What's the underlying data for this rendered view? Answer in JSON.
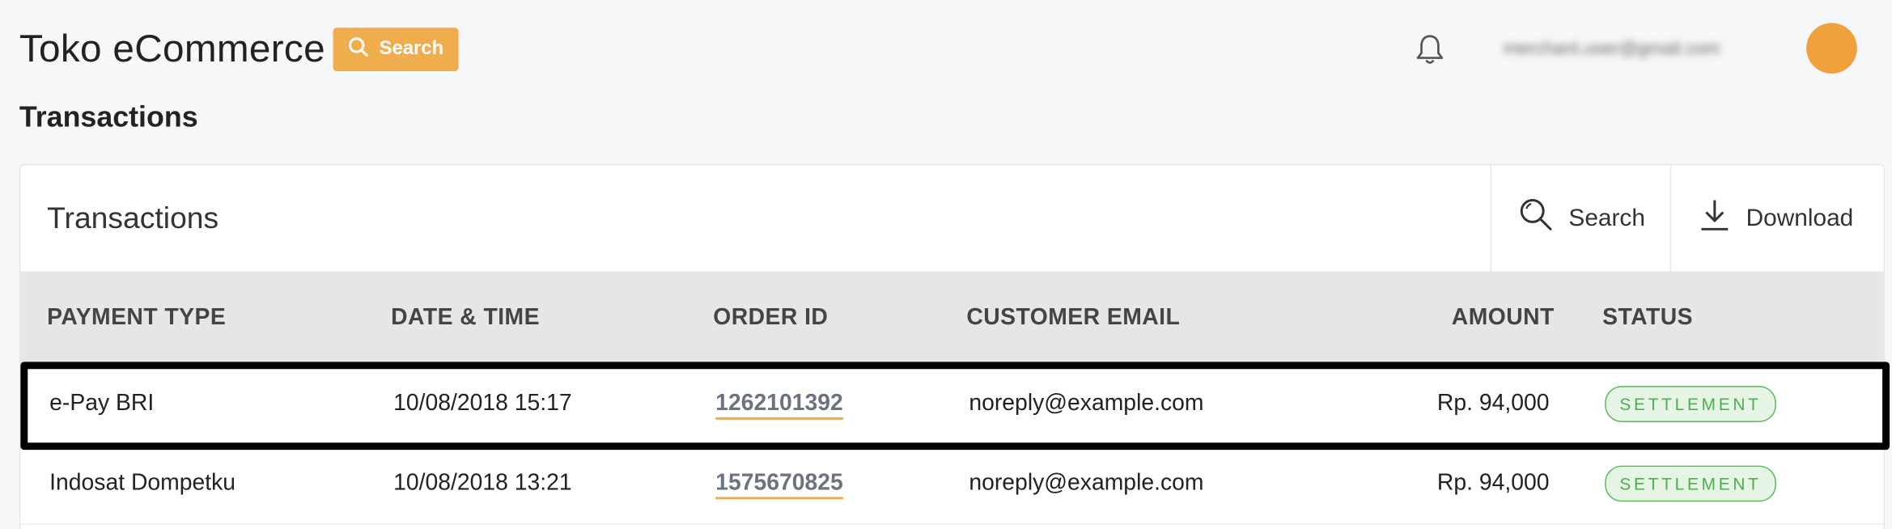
{
  "app": {
    "title": "Toko eCommerce",
    "search_chip_label": "Search",
    "user_email": "merchant.user@gmail.com",
    "accent_color": "#f0ad4e",
    "avatar_color": "#f0a03c"
  },
  "page": {
    "title": "Transactions"
  },
  "card": {
    "title": "Transactions",
    "search_label": "Search",
    "download_label": "Download"
  },
  "table": {
    "columns": [
      "PAYMENT TYPE",
      "DATE & TIME",
      "ORDER ID",
      "CUSTOMER EMAIL",
      "AMOUNT",
      "STATUS"
    ],
    "rows": [
      {
        "payment_type": "e-Pay BRI",
        "datetime": "10/08/2018 15:17",
        "order_id": "1262101392",
        "email": "noreply@example.com",
        "amount": "Rp. 94,000",
        "status": "SETTLEMENT",
        "highlighted": true
      },
      {
        "payment_type": "Indosat Dompetku",
        "datetime": "10/08/2018 13:21",
        "order_id": "1575670825",
        "email": "noreply@example.com",
        "amount": "Rp. 94,000",
        "status": "SETTLEMENT",
        "highlighted": false
      }
    ]
  },
  "icons": {
    "search": "search-icon",
    "bell": "bell-icon",
    "download": "download-icon"
  },
  "colors": {
    "status_settlement_border": "#5cb85c",
    "status_settlement_bg": "#e6f4e6",
    "status_settlement_text": "#4cae4c",
    "order_link_underline": "#f0ad4e"
  }
}
